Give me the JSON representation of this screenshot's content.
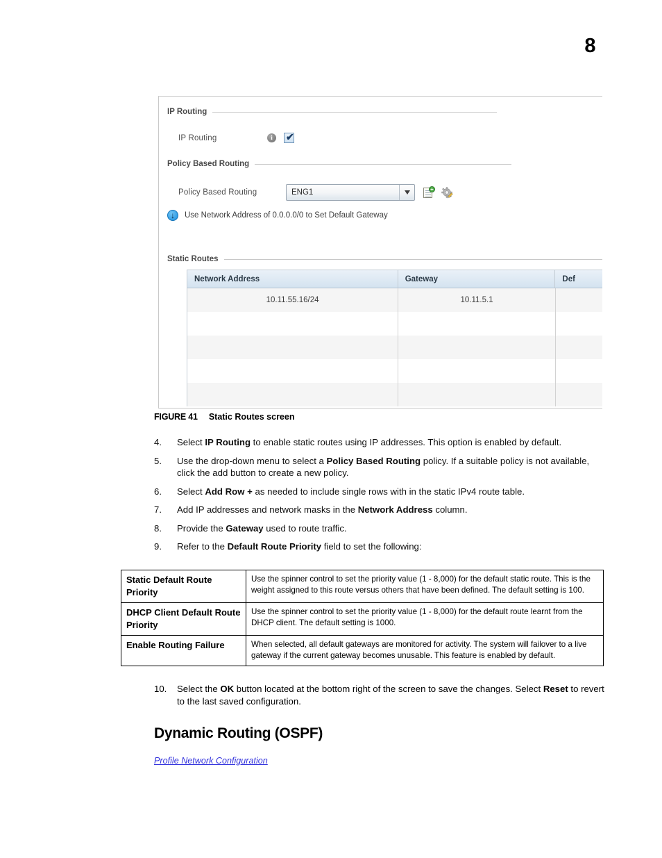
{
  "page": {
    "number": "8"
  },
  "figure": {
    "sections": {
      "ip_routing": {
        "label": "IP Routing"
      },
      "policy_based_routing": {
        "label": "Policy Based Routing"
      },
      "static_routes": {
        "label": "Static Routes"
      }
    },
    "ip_routing_field": {
      "label": "IP Routing",
      "info_glyph": "i",
      "checked": true,
      "tick_glyph": "✔"
    },
    "policy_field": {
      "label": "Policy Based Routing",
      "value": "ENG1",
      "add_icon_plus": "+"
    },
    "note": {
      "glyph": "↓",
      "text": "Use Network Address of 0.0.0.0/0 to Set Default Gateway"
    },
    "grid": {
      "columns": [
        "Network Address",
        "Gateway",
        "Def"
      ],
      "rows": [
        {
          "network_address": "10.11.55.16/24",
          "gateway": "10.11.5.1",
          "default_route_priority": ""
        },
        {
          "network_address": "",
          "gateway": "",
          "default_route_priority": ""
        },
        {
          "network_address": "",
          "gateway": "",
          "default_route_priority": ""
        },
        {
          "network_address": "",
          "gateway": "",
          "default_route_priority": ""
        },
        {
          "network_address": "",
          "gateway": "",
          "default_route_priority": ""
        }
      ]
    }
  },
  "caption": {
    "label": "FIGURE 41",
    "title": "Static Routes screen"
  },
  "steps": [
    {
      "num": "4.",
      "parts": [
        {
          "t": "Select ",
          "b": false
        },
        {
          "t": "IP Routing",
          "b": true
        },
        {
          "t": " to enable static routes using IP addresses. This option is enabled by default.",
          "b": false
        }
      ]
    },
    {
      "num": "5.",
      "parts": [
        {
          "t": "Use the drop-down menu to select a ",
          "b": false
        },
        {
          "t": "Policy Based Routing",
          "b": true
        },
        {
          "t": " policy. If a suitable policy is not available, click the add button to create a new policy.",
          "b": false
        }
      ]
    },
    {
      "num": "6.",
      "parts": [
        {
          "t": "Select ",
          "b": false
        },
        {
          "t": "Add Row +",
          "b": true
        },
        {
          "t": " as needed to include single rows with in the static IPv4 route table.",
          "b": false
        }
      ]
    },
    {
      "num": "7.",
      "parts": [
        {
          "t": "Add IP addresses and network masks in the ",
          "b": false
        },
        {
          "t": "Network Address",
          "b": true
        },
        {
          "t": " column.",
          "b": false
        }
      ]
    },
    {
      "num": "8.",
      "parts": [
        {
          "t": "Provide the ",
          "b": false
        },
        {
          "t": "Gateway",
          "b": true
        },
        {
          "t": " used to route traffic.",
          "b": false
        }
      ]
    },
    {
      "num": "9.",
      "parts": [
        {
          "t": "Refer to the ",
          "b": false
        },
        {
          "t": "Default Route Priority",
          "b": true
        },
        {
          "t": " field to set the following:",
          "b": false
        }
      ]
    }
  ],
  "definition_table": [
    {
      "term": "Static Default Route Priority",
      "description": "Use the spinner control to set the priority value (1 - 8,000) for the default static route. This is the weight assigned to this route versus others that have been defined. The default setting is 100."
    },
    {
      "term": "DHCP Client Default Route Priority",
      "description": "Use the spinner control to set the priority value (1 - 8,000) for the default route learnt from the DHCP client. The default setting is 1000."
    },
    {
      "term": "Enable Routing Failure",
      "description": "When selected, all default gateways are monitored for activity. The system will failover to a live gateway if the current gateway becomes unusable. This feature is enabled by default."
    }
  ],
  "final_step": {
    "num": "10.",
    "parts": [
      {
        "t": "Select the ",
        "b": false
      },
      {
        "t": "OK",
        "b": true
      },
      {
        "t": " button located at the bottom right of the screen to save the changes. Select ",
        "b": false
      },
      {
        "t": "Reset",
        "b": true
      },
      {
        "t": " to revert to the last saved configuration.",
        "b": false
      }
    ]
  },
  "heading": "Dynamic Routing (OSPF)",
  "crosslink": "Profile Network Configuration",
  "colors": {
    "link": "#3333dd",
    "section_label": "#4a4a4a",
    "grid_header_top": "#eaf1f8",
    "grid_header_bottom": "#d4e3f0",
    "row_alt": "#f5f5f5",
    "note_arrow": "#1a8ede",
    "add_plus": "#49a942"
  }
}
